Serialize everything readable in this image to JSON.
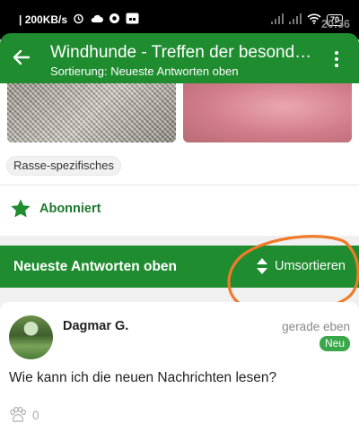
{
  "status_bar": {
    "time": "20:36",
    "speed": "200KB/s",
    "battery": "70",
    "icons": [
      "alarm-icon",
      "cloud-icon",
      "record-icon",
      "app-icon",
      "signal-icon",
      "signal-icon",
      "wifi-icon",
      "battery-icon"
    ]
  },
  "app_bar": {
    "title": "Windhunde - Treffen der besonderen Art",
    "subtitle": "Sortierung: Neueste Antworten oben",
    "back_icon": "arrow-left-icon",
    "more_icon": "more-vertical-icon",
    "color": "#1e8c2f"
  },
  "thread": {
    "tag": "Rasse-spezifisches",
    "subscribe_label": "Abonniert",
    "subscribe_icon": "star-icon"
  },
  "sort_bar": {
    "label": "Neueste Antworten oben",
    "resort_label": "Umsortieren",
    "resort_icon": "sort-icon"
  },
  "posts": [
    {
      "author": "Dagmar G.",
      "time": "gerade eben",
      "badge": "Neu",
      "text": "Wie kann ich die neuen Nachrichten lesen?",
      "likes": "0",
      "like_icon": "paw-icon"
    }
  ],
  "colors": {
    "primary": "#1e8c2f",
    "accent_text": "#1e7a2c",
    "badge": "#3aa84a",
    "annotation": "#f07a2a"
  }
}
